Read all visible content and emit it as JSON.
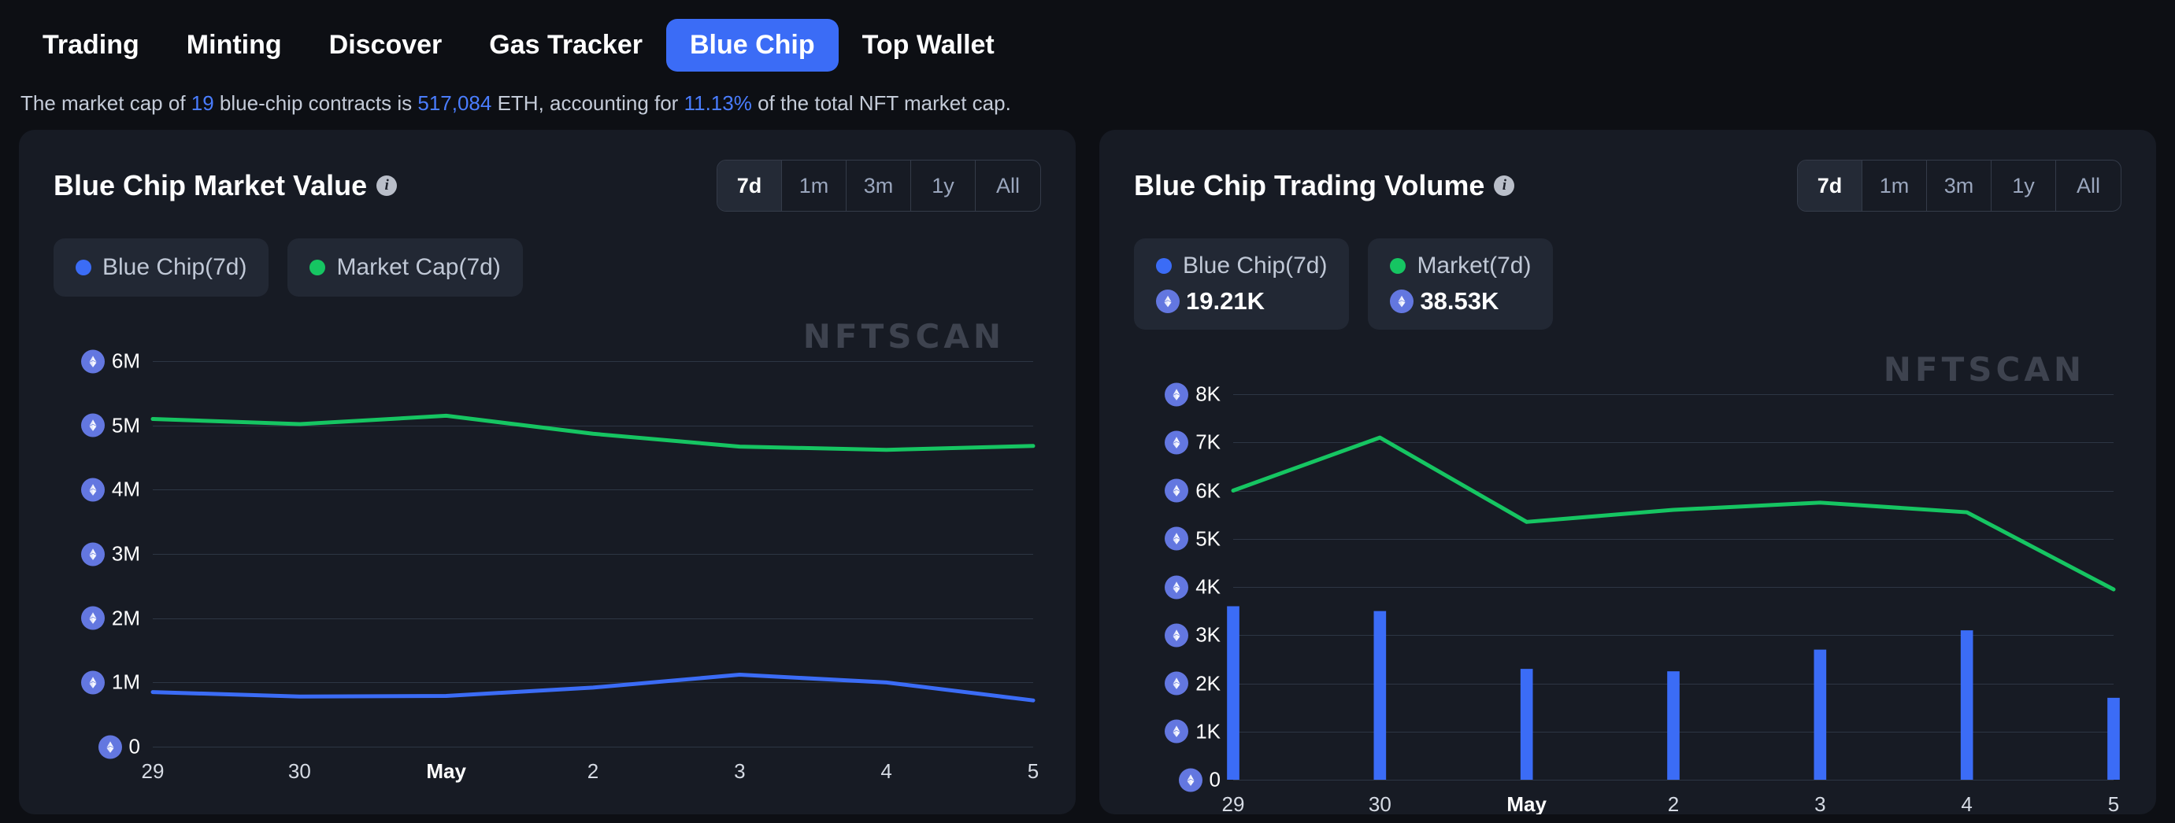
{
  "nav": {
    "items": [
      {
        "label": "Trading",
        "active": false
      },
      {
        "label": "Minting",
        "active": false
      },
      {
        "label": "Discover",
        "active": false
      },
      {
        "label": "Gas Tracker",
        "active": false
      },
      {
        "label": "Blue Chip",
        "active": true
      },
      {
        "label": "Top Wallet",
        "active": false
      }
    ]
  },
  "description": {
    "part1": "The market cap of ",
    "count": "19",
    "part2": " blue-chip contracts is ",
    "marketcap": "517,084",
    "part3": " ETH, accounting for ",
    "percent": "11.13%",
    "part4": " of the total NFT market cap."
  },
  "watermark": "NFTSCAN",
  "colors": {
    "accent_blue": "#3b6cf6",
    "accent_green": "#16c562",
    "page_bg": "#0d0f14",
    "card_bg": "#171b24",
    "grid": "#2d3644"
  },
  "range_options": [
    "7d",
    "1m",
    "3m",
    "1y",
    "All"
  ],
  "range_selected": "7d",
  "left_card": {
    "title": "Blue Chip Market Value",
    "info_icon": "info-icon",
    "legend": [
      {
        "label": "Blue Chip(7d)",
        "color": "#3b6cf6",
        "value": null
      },
      {
        "label": "Market Cap(7d)",
        "color": "#16c562",
        "value": null
      }
    ]
  },
  "right_card": {
    "title": "Blue Chip Trading Volume",
    "info_icon": "info-icon",
    "legend": [
      {
        "label": "Blue Chip(7d)",
        "color": "#3b6cf6",
        "value": "19.21K"
      },
      {
        "label": "Market(7d)",
        "color": "#16c562",
        "value": "38.53K"
      }
    ]
  },
  "chart_data": [
    {
      "type": "line",
      "title": "Blue Chip Market Value",
      "xlabel": "",
      "ylabel": "ETH",
      "categories": [
        "29",
        "30",
        "May",
        "2",
        "3",
        "4",
        "5"
      ],
      "ytick_labels": [
        "6M",
        "5M",
        "4M",
        "3M",
        "2M",
        "1M",
        "0"
      ],
      "ytick_values": [
        6000000,
        5000000,
        4000000,
        3000000,
        2000000,
        1000000,
        0
      ],
      "ylim": [
        0,
        6000000
      ],
      "grid": true,
      "legend_position": "top-left",
      "series": [
        {
          "name": "Blue Chip(7d)",
          "color": "#3b6cf6",
          "values": [
            850000,
            780000,
            790000,
            920000,
            1120000,
            1000000,
            720000
          ]
        },
        {
          "name": "Market Cap(7d)",
          "color": "#16c562",
          "values": [
            5100000,
            5020000,
            5150000,
            4870000,
            4670000,
            4620000,
            4680000
          ]
        }
      ]
    },
    {
      "type": "bar",
      "title": "Blue Chip Trading Volume",
      "xlabel": "",
      "ylabel": "ETH",
      "categories": [
        "29",
        "30",
        "May",
        "2",
        "3",
        "4",
        "5"
      ],
      "ytick_labels": [
        "8K",
        "7K",
        "6K",
        "5K",
        "4K",
        "3K",
        "2K",
        "1K",
        "0"
      ],
      "ytick_values": [
        8000,
        7000,
        6000,
        5000,
        4000,
        3000,
        2000,
        1000,
        0
      ],
      "ylim": [
        0,
        8000
      ],
      "grid": true,
      "legend_position": "top-left",
      "series": [
        {
          "name": "Blue Chip(7d)",
          "type": "bar",
          "color": "#3b6cf6",
          "values": [
            3600,
            3500,
            2300,
            2250,
            2700,
            3100,
            1700
          ]
        },
        {
          "name": "Market(7d)",
          "type": "line",
          "color": "#16c562",
          "values": [
            6000,
            7100,
            5350,
            5600,
            5750,
            5550,
            3950
          ]
        }
      ]
    }
  ]
}
